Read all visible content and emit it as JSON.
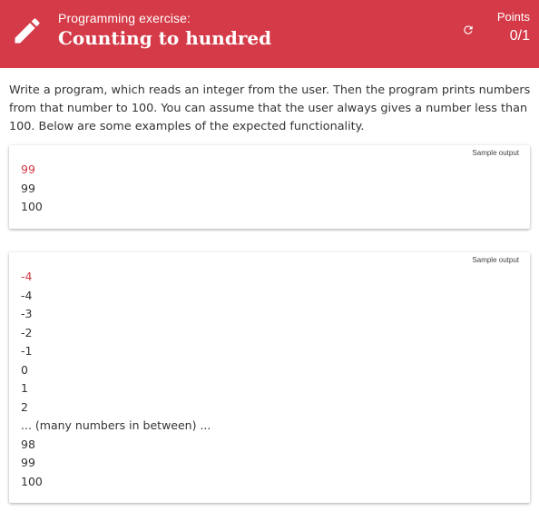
{
  "header": {
    "kicker": "Programming exercise:",
    "title": "Counting to hundred",
    "points_label": "Points",
    "points_value": "0/1",
    "accent_color": "#d43a47",
    "icons": [
      "pencil-icon",
      "refresh-icon"
    ]
  },
  "description": "Write a program, which reads an integer from the user. Then the program prints numbers from that number to 100. You can assume that the user always gives a number less than 100. Below are some examples of the expected functionality.",
  "samples": [
    {
      "label": "Sample output",
      "lines": [
        {
          "text": "99",
          "user_input": true
        },
        {
          "text": "99",
          "user_input": false
        },
        {
          "text": "100",
          "user_input": false
        }
      ]
    },
    {
      "label": "Sample output",
      "lines": [
        {
          "text": "-4",
          "user_input": true
        },
        {
          "text": "-4",
          "user_input": false
        },
        {
          "text": "-3",
          "user_input": false
        },
        {
          "text": "-2",
          "user_input": false
        },
        {
          "text": "-1",
          "user_input": false
        },
        {
          "text": "0",
          "user_input": false
        },
        {
          "text": "1",
          "user_input": false
        },
        {
          "text": "2",
          "user_input": false
        },
        {
          "text": "... (many numbers in between) ...",
          "user_input": false
        },
        {
          "text": "98",
          "user_input": false
        },
        {
          "text": "99",
          "user_input": false
        },
        {
          "text": "100",
          "user_input": false
        }
      ]
    }
  ]
}
